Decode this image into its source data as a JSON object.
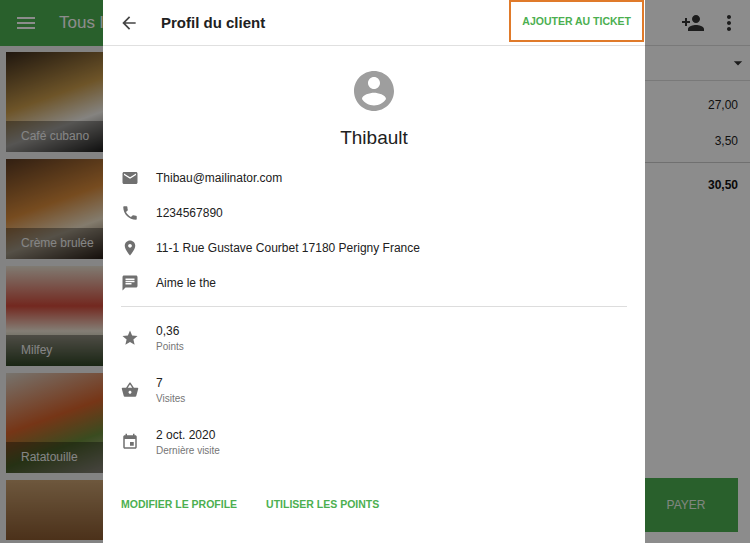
{
  "app_bar": {
    "title": "Tous le"
  },
  "products": [
    {
      "name": "Café cubano"
    },
    {
      "name": "Crème brulée"
    },
    {
      "name": "Milfey"
    },
    {
      "name": "Ratatouille"
    }
  ],
  "ticket": {
    "lines": [
      {
        "amount": "27,00"
      },
      {
        "amount": "3,50"
      }
    ],
    "total": "30,50",
    "pay_button": "PAYER"
  },
  "dialog": {
    "title": "Profil du client",
    "action": {
      "label": "AJOUTER AU TICKET",
      "highlighted": true
    },
    "customer": {
      "name": "Thibault"
    },
    "contacts": [
      {
        "kind": "email",
        "text": "Thibau@mailinator.com"
      },
      {
        "kind": "phone",
        "text": "1234567890"
      },
      {
        "kind": "address",
        "text": "11-1 Rue Gustave Courbet 17180 Perigny France"
      },
      {
        "kind": "note",
        "text": "Aime le the"
      }
    ],
    "stats": [
      {
        "kind": "points",
        "value": "0,36",
        "label": "Points"
      },
      {
        "kind": "visits",
        "value": "7",
        "label": "Visites"
      },
      {
        "kind": "last_visit",
        "value": "2 oct. 2020",
        "label": "Dernière visite"
      }
    ],
    "footer_buttons": [
      "MODIFIER LE PROFILE",
      "UTILISER LES POINTS"
    ]
  }
}
